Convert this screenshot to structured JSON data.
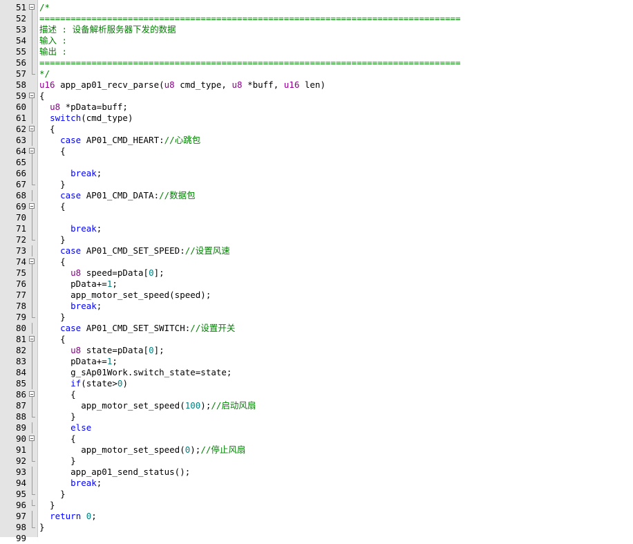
{
  "editor": {
    "lines": [
      {
        "num": "51",
        "fold": "box",
        "tokens": [
          {
            "t": "/*",
            "c": "comment"
          }
        ]
      },
      {
        "num": "52",
        "fold": "line",
        "tokens": [
          {
            "t": "=================================================================================",
            "c": "comment"
          }
        ]
      },
      {
        "num": "53",
        "fold": "line",
        "tokens": [
          {
            "t": "描述 : 设备解析服务器下发的数据",
            "c": "comment"
          }
        ]
      },
      {
        "num": "54",
        "fold": "line",
        "tokens": [
          {
            "t": "输入 :",
            "c": "comment"
          }
        ]
      },
      {
        "num": "55",
        "fold": "line",
        "tokens": [
          {
            "t": "输出 :",
            "c": "comment"
          }
        ]
      },
      {
        "num": "56",
        "fold": "line",
        "tokens": [
          {
            "t": "=================================================================================",
            "c": "comment"
          }
        ]
      },
      {
        "num": "57",
        "fold": "end",
        "tokens": [
          {
            "t": "*/",
            "c": "comment"
          }
        ]
      },
      {
        "num": "58",
        "fold": "",
        "tokens": [
          {
            "t": "u16",
            "c": "type"
          },
          {
            "t": " app_ap01_recv_parse(",
            "c": "text"
          },
          {
            "t": "u8",
            "c": "type"
          },
          {
            "t": " cmd_type, ",
            "c": "text"
          },
          {
            "t": "u8",
            "c": "type"
          },
          {
            "t": " *buff, ",
            "c": "text"
          },
          {
            "t": "u16",
            "c": "type"
          },
          {
            "t": " len)",
            "c": "text"
          }
        ]
      },
      {
        "num": "59",
        "fold": "box",
        "tokens": [
          {
            "t": "{",
            "c": "text"
          }
        ]
      },
      {
        "num": "60",
        "fold": "line",
        "tokens": [
          {
            "t": "  ",
            "c": "text"
          },
          {
            "t": "u8",
            "c": "type"
          },
          {
            "t": " *pData=buff;",
            "c": "text"
          }
        ]
      },
      {
        "num": "61",
        "fold": "line",
        "tokens": [
          {
            "t": "  ",
            "c": "text"
          },
          {
            "t": "switch",
            "c": "kw"
          },
          {
            "t": "(cmd_type)",
            "c": "text"
          }
        ]
      },
      {
        "num": "62",
        "fold": "box",
        "tokens": [
          {
            "t": "  {",
            "c": "text"
          }
        ]
      },
      {
        "num": "63",
        "fold": "line",
        "tokens": [
          {
            "t": "    ",
            "c": "text"
          },
          {
            "t": "case",
            "c": "kw"
          },
          {
            "t": " AP01_CMD_HEART:",
            "c": "text"
          },
          {
            "t": "//心跳包",
            "c": "comment"
          }
        ]
      },
      {
        "num": "64",
        "fold": "box",
        "tokens": [
          {
            "t": "    {",
            "c": "text"
          }
        ]
      },
      {
        "num": "65",
        "fold": "line",
        "tokens": []
      },
      {
        "num": "66",
        "fold": "line",
        "tokens": [
          {
            "t": "      ",
            "c": "text"
          },
          {
            "t": "break",
            "c": "kw"
          },
          {
            "t": ";",
            "c": "text"
          }
        ]
      },
      {
        "num": "67",
        "fold": "end",
        "tokens": [
          {
            "t": "    }",
            "c": "text"
          }
        ]
      },
      {
        "num": "68",
        "fold": "line",
        "tokens": [
          {
            "t": "    ",
            "c": "text"
          },
          {
            "t": "case",
            "c": "kw"
          },
          {
            "t": " AP01_CMD_DATA:",
            "c": "text"
          },
          {
            "t": "//数据包",
            "c": "comment"
          }
        ]
      },
      {
        "num": "69",
        "fold": "box",
        "tokens": [
          {
            "t": "    {",
            "c": "text"
          }
        ]
      },
      {
        "num": "70",
        "fold": "line",
        "tokens": []
      },
      {
        "num": "71",
        "fold": "line",
        "tokens": [
          {
            "t": "      ",
            "c": "text"
          },
          {
            "t": "break",
            "c": "kw"
          },
          {
            "t": ";",
            "c": "text"
          }
        ]
      },
      {
        "num": "72",
        "fold": "end",
        "tokens": [
          {
            "t": "    }",
            "c": "text"
          }
        ]
      },
      {
        "num": "73",
        "fold": "line",
        "tokens": [
          {
            "t": "    ",
            "c": "text"
          },
          {
            "t": "case",
            "c": "kw"
          },
          {
            "t": " AP01_CMD_SET_SPEED:",
            "c": "text"
          },
          {
            "t": "//设置风速",
            "c": "comment"
          }
        ]
      },
      {
        "num": "74",
        "fold": "box",
        "tokens": [
          {
            "t": "    {",
            "c": "text"
          }
        ]
      },
      {
        "num": "75",
        "fold": "line",
        "tokens": [
          {
            "t": "      ",
            "c": "text"
          },
          {
            "t": "u8",
            "c": "type"
          },
          {
            "t": " speed=pData[",
            "c": "text"
          },
          {
            "t": "0",
            "c": "num"
          },
          {
            "t": "];",
            "c": "text"
          }
        ]
      },
      {
        "num": "76",
        "fold": "line",
        "tokens": [
          {
            "t": "      pData+=",
            "c": "text"
          },
          {
            "t": "1",
            "c": "num"
          },
          {
            "t": ";",
            "c": "text"
          }
        ]
      },
      {
        "num": "77",
        "fold": "line",
        "tokens": [
          {
            "t": "      app_motor_set_speed(speed);",
            "c": "text"
          }
        ]
      },
      {
        "num": "78",
        "fold": "line",
        "tokens": [
          {
            "t": "      ",
            "c": "text"
          },
          {
            "t": "break",
            "c": "kw"
          },
          {
            "t": ";",
            "c": "text"
          }
        ]
      },
      {
        "num": "79",
        "fold": "end",
        "tokens": [
          {
            "t": "    }",
            "c": "text"
          }
        ]
      },
      {
        "num": "80",
        "fold": "line",
        "tokens": [
          {
            "t": "    ",
            "c": "text"
          },
          {
            "t": "case",
            "c": "kw"
          },
          {
            "t": " AP01_CMD_SET_SWITCH:",
            "c": "text"
          },
          {
            "t": "//设置开关",
            "c": "comment"
          }
        ]
      },
      {
        "num": "81",
        "fold": "box",
        "tokens": [
          {
            "t": "    {",
            "c": "text"
          }
        ]
      },
      {
        "num": "82",
        "fold": "line",
        "tokens": [
          {
            "t": "      ",
            "c": "text"
          },
          {
            "t": "u8",
            "c": "type"
          },
          {
            "t": " state=pData[",
            "c": "text"
          },
          {
            "t": "0",
            "c": "num"
          },
          {
            "t": "];",
            "c": "text"
          }
        ]
      },
      {
        "num": "83",
        "fold": "line",
        "tokens": [
          {
            "t": "      pData+=",
            "c": "text"
          },
          {
            "t": "1",
            "c": "num"
          },
          {
            "t": ";",
            "c": "text"
          }
        ]
      },
      {
        "num": "84",
        "fold": "line",
        "tokens": [
          {
            "t": "      g_sAp01Work.switch_state=state;",
            "c": "text"
          }
        ]
      },
      {
        "num": "85",
        "fold": "line",
        "tokens": [
          {
            "t": "      ",
            "c": "text"
          },
          {
            "t": "if",
            "c": "kw"
          },
          {
            "t": "(state>",
            "c": "text"
          },
          {
            "t": "0",
            "c": "num"
          },
          {
            "t": ")",
            "c": "text"
          }
        ]
      },
      {
        "num": "86",
        "fold": "box",
        "tokens": [
          {
            "t": "      {",
            "c": "text"
          }
        ]
      },
      {
        "num": "87",
        "fold": "line",
        "tokens": [
          {
            "t": "        app_motor_set_speed(",
            "c": "text"
          },
          {
            "t": "100",
            "c": "num"
          },
          {
            "t": ");",
            "c": "text"
          },
          {
            "t": "//启动风扇",
            "c": "comment"
          }
        ]
      },
      {
        "num": "88",
        "fold": "end",
        "tokens": [
          {
            "t": "      }",
            "c": "text"
          }
        ]
      },
      {
        "num": "89",
        "fold": "line",
        "tokens": [
          {
            "t": "      ",
            "c": "text"
          },
          {
            "t": "else",
            "c": "kw"
          }
        ]
      },
      {
        "num": "90",
        "fold": "box",
        "tokens": [
          {
            "t": "      {",
            "c": "text"
          }
        ]
      },
      {
        "num": "91",
        "fold": "line",
        "tokens": [
          {
            "t": "        app_motor_set_speed(",
            "c": "text"
          },
          {
            "t": "0",
            "c": "num"
          },
          {
            "t": ");",
            "c": "text"
          },
          {
            "t": "//停止风扇",
            "c": "comment"
          }
        ]
      },
      {
        "num": "92",
        "fold": "end",
        "tokens": [
          {
            "t": "      }",
            "c": "text"
          }
        ]
      },
      {
        "num": "93",
        "fold": "line",
        "tokens": [
          {
            "t": "      app_ap01_send_status();",
            "c": "text"
          }
        ]
      },
      {
        "num": "94",
        "fold": "line",
        "tokens": [
          {
            "t": "      ",
            "c": "text"
          },
          {
            "t": "break",
            "c": "kw"
          },
          {
            "t": ";",
            "c": "text"
          }
        ]
      },
      {
        "num": "95",
        "fold": "end",
        "tokens": [
          {
            "t": "    }",
            "c": "text"
          }
        ]
      },
      {
        "num": "96",
        "fold": "end",
        "tokens": [
          {
            "t": "  }",
            "c": "text"
          }
        ]
      },
      {
        "num": "97",
        "fold": "line",
        "tokens": [
          {
            "t": "  ",
            "c": "text"
          },
          {
            "t": "return",
            "c": "kw"
          },
          {
            "t": " ",
            "c": "text"
          },
          {
            "t": "0",
            "c": "num"
          },
          {
            "t": ";",
            "c": "text"
          }
        ]
      },
      {
        "num": "98",
        "fold": "end",
        "tokens": [
          {
            "t": "}",
            "c": "text"
          }
        ]
      },
      {
        "num": "99",
        "fold": "",
        "tokens": []
      }
    ]
  }
}
